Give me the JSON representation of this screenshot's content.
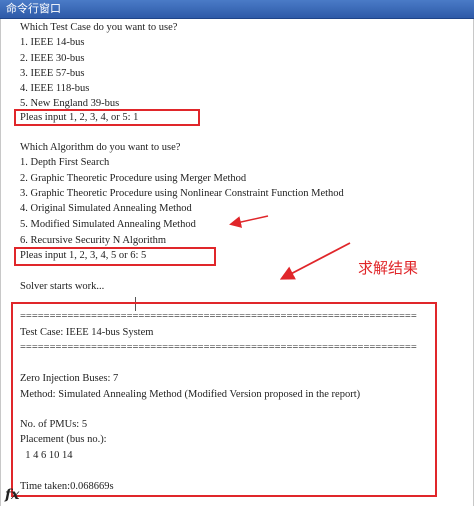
{
  "window": {
    "title": "命令行窗口"
  },
  "console": {
    "lines": [
      "Which Test Case do you want to use?",
      "1. IEEE 14-bus",
      "2. IEEE 30-bus",
      "3. IEEE 57-bus",
      "4. IEEE 118-bus",
      "5. New England 39-bus",
      "Pleas input 1, 2, 3, 4, or 5: 1",
      "Which Algorithm do you want to use?",
      "1. Depth First Search",
      "2. Graphic Theoretic Procedure using Merger Method",
      "3. Graphic Theoretic Procedure using Nonlinear Constraint Function Method",
      "4. Original Simulated Annealing Method",
      "5. Modified Simulated Annealing Method",
      "6. Recursive Security N Algorithm",
      "Pleas input 1, 2, 3, 4, 5 or 6: 5",
      "Solver starts work...",
      "===================================================================",
      "Test Case: IEEE 14-bus System",
      "===================================================================",
      "Zero Injection Buses: 7",
      "Method: Simulated Annealing Method (Modified Version proposed in the report)",
      "No. of PMUs: 5",
      "Placement (bus no.):",
      "  1 4 6 10 14",
      "Time taken:0.068669s"
    ]
  },
  "annotation": {
    "label": "求解结果",
    "color": "#e0262a"
  },
  "prompt_icon": "fx"
}
